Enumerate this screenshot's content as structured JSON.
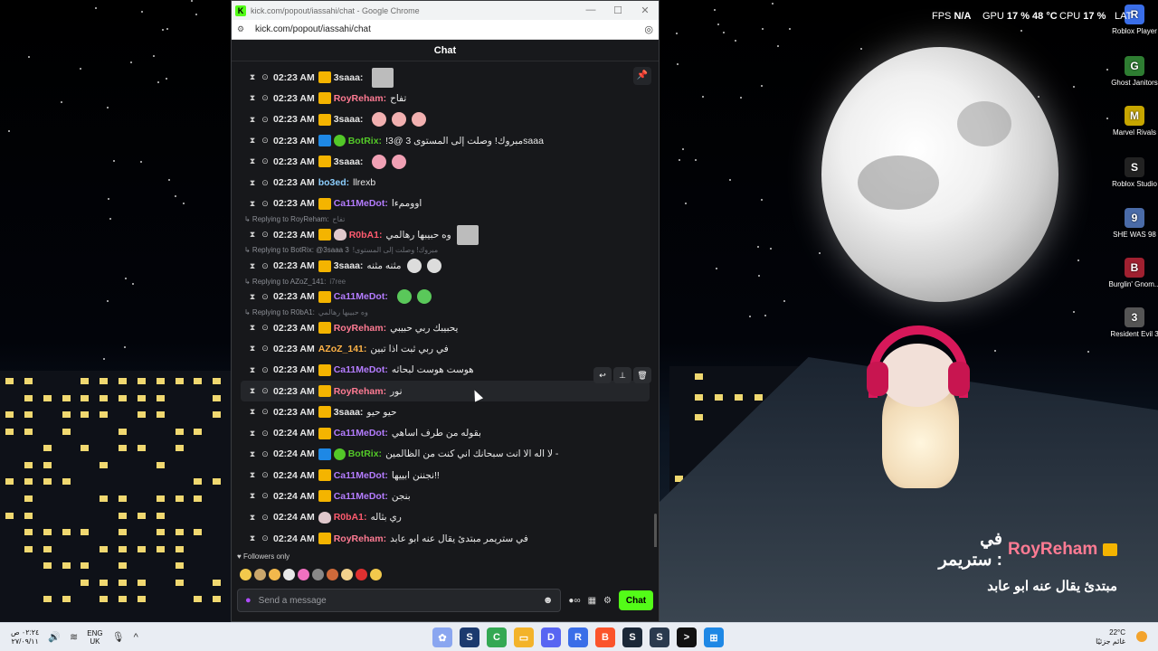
{
  "browser": {
    "window_title": "kick.com/popout/iassahi/chat - Google Chrome",
    "url": "kick.com/popout/iassahi/chat",
    "favicon_letter": "K"
  },
  "chat": {
    "header": "Chat",
    "followers_only": "Followers only",
    "input_placeholder": "Send a message",
    "send_label": "Chat",
    "messages": [
      {
        "time": "02:23 AM",
        "user": "3saaa:",
        "color": "#e5e5e5",
        "badges": [
          "sub"
        ],
        "text": "",
        "emotes": [
          "sq"
        ]
      },
      {
        "time": "02:23 AM",
        "user": "RoyReham:",
        "color": "#ff7b93",
        "badges": [
          "sub"
        ],
        "text": "تفاح",
        "emotes": []
      },
      {
        "time": "02:23 AM",
        "user": "3saaa:",
        "color": "#e5e5e5",
        "badges": [
          "sub"
        ],
        "text": "",
        "emotes": [
          "#f1b0b0",
          "#f1b0b0",
          "#f1b0b0"
        ]
      },
      {
        "time": "02:23 AM",
        "user": "BotRix:",
        "color": "#53c828",
        "badges": [
          "bot",
          "verified"
        ],
        "text": "!مبروك! وصلت إلى المستوى 3 @3saaa",
        "emotes": []
      },
      {
        "time": "02:23 AM",
        "user": "3saaa:",
        "color": "#e5e5e5",
        "badges": [
          "sub"
        ],
        "text": "",
        "emotes": [
          "#f0a0b4",
          "#f0a0b4"
        ]
      },
      {
        "time": "02:23 AM",
        "user": "bo3ed:",
        "color": "#8ccfff",
        "badges": [],
        "text": "llrexb",
        "emotes": []
      },
      {
        "time": "02:23 AM",
        "user": "Ca11MeDot:",
        "color": "#b47cff",
        "badges": [
          "sub"
        ],
        "text": "اووممءا",
        "emotes": []
      },
      {
        "reply": "Replying to RoyReham:",
        "reply_text": "تفاح"
      },
      {
        "time": "02:23 AM",
        "user": "R0bA1:",
        "color": "#ff5a6e",
        "badges": [
          "sub",
          "heart"
        ],
        "text": "وه حبيبها رهالمي",
        "emotes": [
          "sq"
        ]
      },
      {
        "reply": "Replying to BotRix: @3saaa 3",
        "reply_text": "!مبروك! وصلت إلى المستوى"
      },
      {
        "time": "02:23 AM",
        "user": "3saaa:",
        "color": "#e5e5e5",
        "badges": [
          "sub"
        ],
        "text": "مثنه مثنه",
        "emotes": [
          "#dcdcdc",
          "#dcdcdc"
        ]
      },
      {
        "reply": "Replying to AZoZ_141:",
        "reply_text": "i7ree"
      },
      {
        "time": "02:23 AM",
        "user": "Ca11MeDot:",
        "color": "#b47cff",
        "badges": [
          "sub"
        ],
        "text": "",
        "emotes": [
          "#5ac85a",
          "#5ac85a"
        ]
      },
      {
        "reply": "Replying to R0bA1:",
        "reply_text": "وه حبيبها رهالمي"
      },
      {
        "time": "02:23 AM",
        "user": "RoyReham:",
        "color": "#ff7b93",
        "badges": [
          "sub"
        ],
        "text": "يحبيبك ربي حبيبي",
        "emotes": []
      },
      {
        "time": "02:23 AM",
        "user": "AZoZ_141:",
        "color": "#ffb347",
        "badges": [],
        "text": "في ربي ثبت اذا تبين",
        "emotes": []
      },
      {
        "time": "02:23 AM",
        "user": "Ca11MeDot:",
        "color": "#b47cff",
        "badges": [
          "sub"
        ],
        "text": "هوست هوست لبحاثه",
        "emotes": []
      },
      {
        "time": "02:23 AM",
        "user": "RoyReham:",
        "color": "#ff7b93",
        "badges": [
          "sub"
        ],
        "text": "نور",
        "emotes": [],
        "hover": true
      },
      {
        "time": "02:23 AM",
        "user": "3saaa:",
        "color": "#e5e5e5",
        "badges": [
          "sub"
        ],
        "text": "حيو حيو",
        "emotes": []
      },
      {
        "time": "02:24 AM",
        "user": "Ca11MeDot:",
        "color": "#b47cff",
        "badges": [
          "sub"
        ],
        "text": "بقوله من طرف اساهي",
        "emotes": []
      },
      {
        "time": "02:24 AM",
        "user": "BotRix:",
        "color": "#53c828",
        "badges": [
          "bot",
          "verified"
        ],
        "text": "لا اله الا انت سبحانك اني كنت من الظالمين -",
        "emotes": []
      },
      {
        "time": "02:24 AM",
        "user": "Ca11MeDot:",
        "color": "#b47cff",
        "badges": [
          "sub"
        ],
        "text": "نجننن ابييها!!",
        "emotes": []
      },
      {
        "time": "02:24 AM",
        "user": "Ca11MeDot:",
        "color": "#b47cff",
        "badges": [
          "sub"
        ],
        "text": "بنجن",
        "emotes": []
      },
      {
        "time": "02:24 AM",
        "user": "R0bA1:",
        "color": "#ff5a6e",
        "badges": [
          "heart"
        ],
        "text": "ري بثاله",
        "emotes": []
      },
      {
        "time": "02:24 AM",
        "user": "RoyReham:",
        "color": "#ff7b93",
        "badges": [
          "sub"
        ],
        "text": "في ستريمر مبتدئ يقال عنه ابو عابد",
        "emotes": []
      }
    ]
  },
  "hud": {
    "fps_label": "FPS",
    "fps_value": "N/A",
    "gpu_label": "GPU",
    "gpu_value": "17 % 48 °C",
    "cpu_label": "CPU",
    "cpu_value": "17 %",
    "lat_label": "LAT"
  },
  "stream_alert": {
    "prefix": "في ستريمر :",
    "user": "RoyReham",
    "line2": "مبتدئ يقال عنه ابو عابد"
  },
  "desktop_icons": [
    {
      "label": "Roblox Player",
      "color": "#3a6ee8",
      "glyph": "R"
    },
    {
      "label": "Ghost Janitors",
      "color": "#2e7d32",
      "glyph": "G"
    },
    {
      "label": "Marvel Rivals",
      "color": "#c7a600",
      "glyph": "M"
    },
    {
      "label": "Roblox Studio",
      "color": "#222222",
      "glyph": "S"
    },
    {
      "label": "SHE WAS 98",
      "color": "#4a6ba8",
      "glyph": "9"
    },
    {
      "label": "Burglin' Gnom...",
      "color": "#a02030",
      "glyph": "B"
    },
    {
      "label": "Resident Evil 3",
      "color": "#555555",
      "glyph": "3"
    }
  ],
  "taskbar": {
    "time": "٠٢:٢٤ ص",
    "date": "٢٧/٠٩/١١",
    "lang_top": "ENG",
    "lang_bottom": "UK",
    "weather_temp": "22°C",
    "weather_desc": "غائم جزئيًا",
    "apps": [
      {
        "name": "app-1",
        "color": "#8aa6f0",
        "glyph": "✿"
      },
      {
        "name": "app-2",
        "color": "#1c3a6e",
        "glyph": "S"
      },
      {
        "name": "app-chrome",
        "color": "#34a853",
        "glyph": "C"
      },
      {
        "name": "app-explorer",
        "color": "#f3b32a",
        "glyph": "▭"
      },
      {
        "name": "app-discord",
        "color": "#5865f2",
        "glyph": "D"
      },
      {
        "name": "app-roblox",
        "color": "#3a6ee8",
        "glyph": "R"
      },
      {
        "name": "app-brave",
        "color": "#fb542b",
        "glyph": "B"
      },
      {
        "name": "app-steam",
        "color": "#1b2838",
        "glyph": "S"
      },
      {
        "name": "app-steam2",
        "color": "#2a3a4e",
        "glyph": "S"
      },
      {
        "name": "app-terminal",
        "color": "#111111",
        "glyph": ">"
      },
      {
        "name": "app-start",
        "color": "#1e88e5",
        "glyph": "⊞"
      }
    ]
  }
}
